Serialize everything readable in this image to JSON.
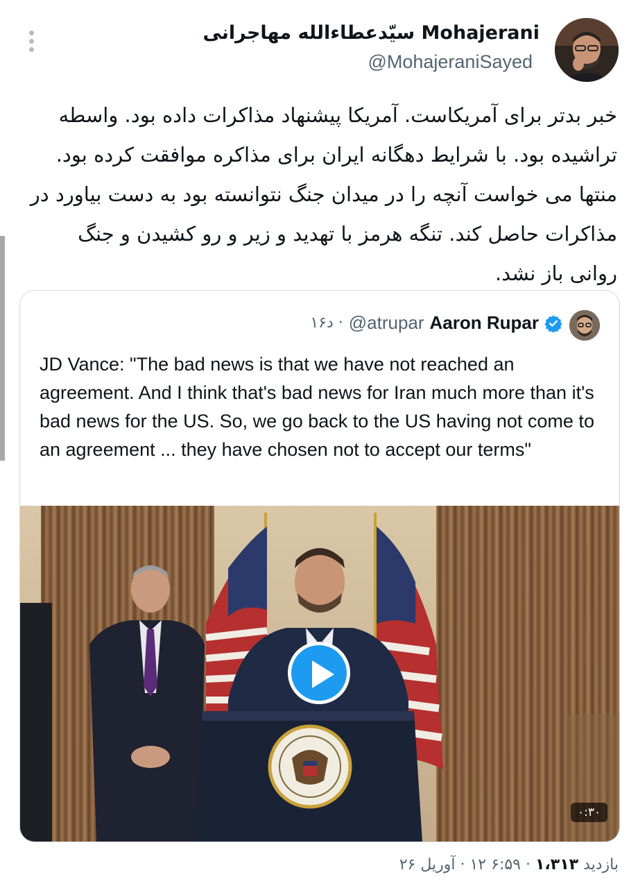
{
  "author": {
    "display_name": "سیّدعطاءالله مهاجرانی Mohajerani",
    "handle": "@MohajeraniSayed"
  },
  "tweet": {
    "text": "خبر بدتر برای آمریکاست. آمریکا پیشنهاد مذاکرات داده بود. واسطه تراشیده بود. با شرایط دهگانه ایران برای مذاکره موافقت کرده بود. منتها می خواست آنچه را در میدان جنگ نتوانسته بود به دست بیاورد در مذاکرات حاصل کند. تنگه هرمز با تهدید و زیر و رو کشیدن و جنگ روانی باز نشد."
  },
  "quoted": {
    "name": "Aaron Rupar",
    "handle": "@atrupar",
    "time": "۱۶د ·",
    "text": "JD Vance: \"The bad news is that we have not reached an agreement. And I think that's bad news for Iran much more than it's bad news for the US. So, we go back to the US having not come to an agreement ... they have chosen not to accept our terms\"",
    "video_duration": "۰:۳۰"
  },
  "footer": {
    "views_label": "بازدید",
    "views_count": "۱،۳۱۳",
    "time": "۶:۵۹ ۱۲ ·",
    "date": "آوریل ۲۶"
  },
  "colors": {
    "accent": "#1d9bf0",
    "muted": "#536471",
    "border": "#cfd9de"
  }
}
